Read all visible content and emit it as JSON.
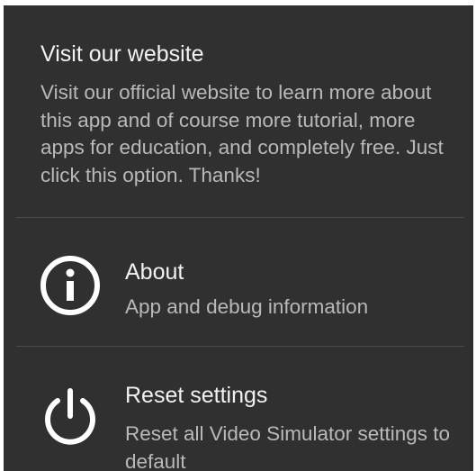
{
  "preferences": [
    {
      "title": "Visit our website",
      "summary": "Visit our official website to learn more about this app and of course more tutorial, more apps for education, and completely free. Just click this option. Thanks!"
    },
    {
      "icon": "info-icon",
      "title": "About",
      "summary": "App and debug information"
    },
    {
      "icon": "power-icon",
      "title": "Reset settings",
      "summary": "Reset all Video Simulator settings to default"
    }
  ],
  "colors": {
    "background": "#303030",
    "title_text": "#f2f2f2",
    "summary_text": "#b9b9b9",
    "divider": "#4a4a4a",
    "icon": "#ffffff"
  }
}
